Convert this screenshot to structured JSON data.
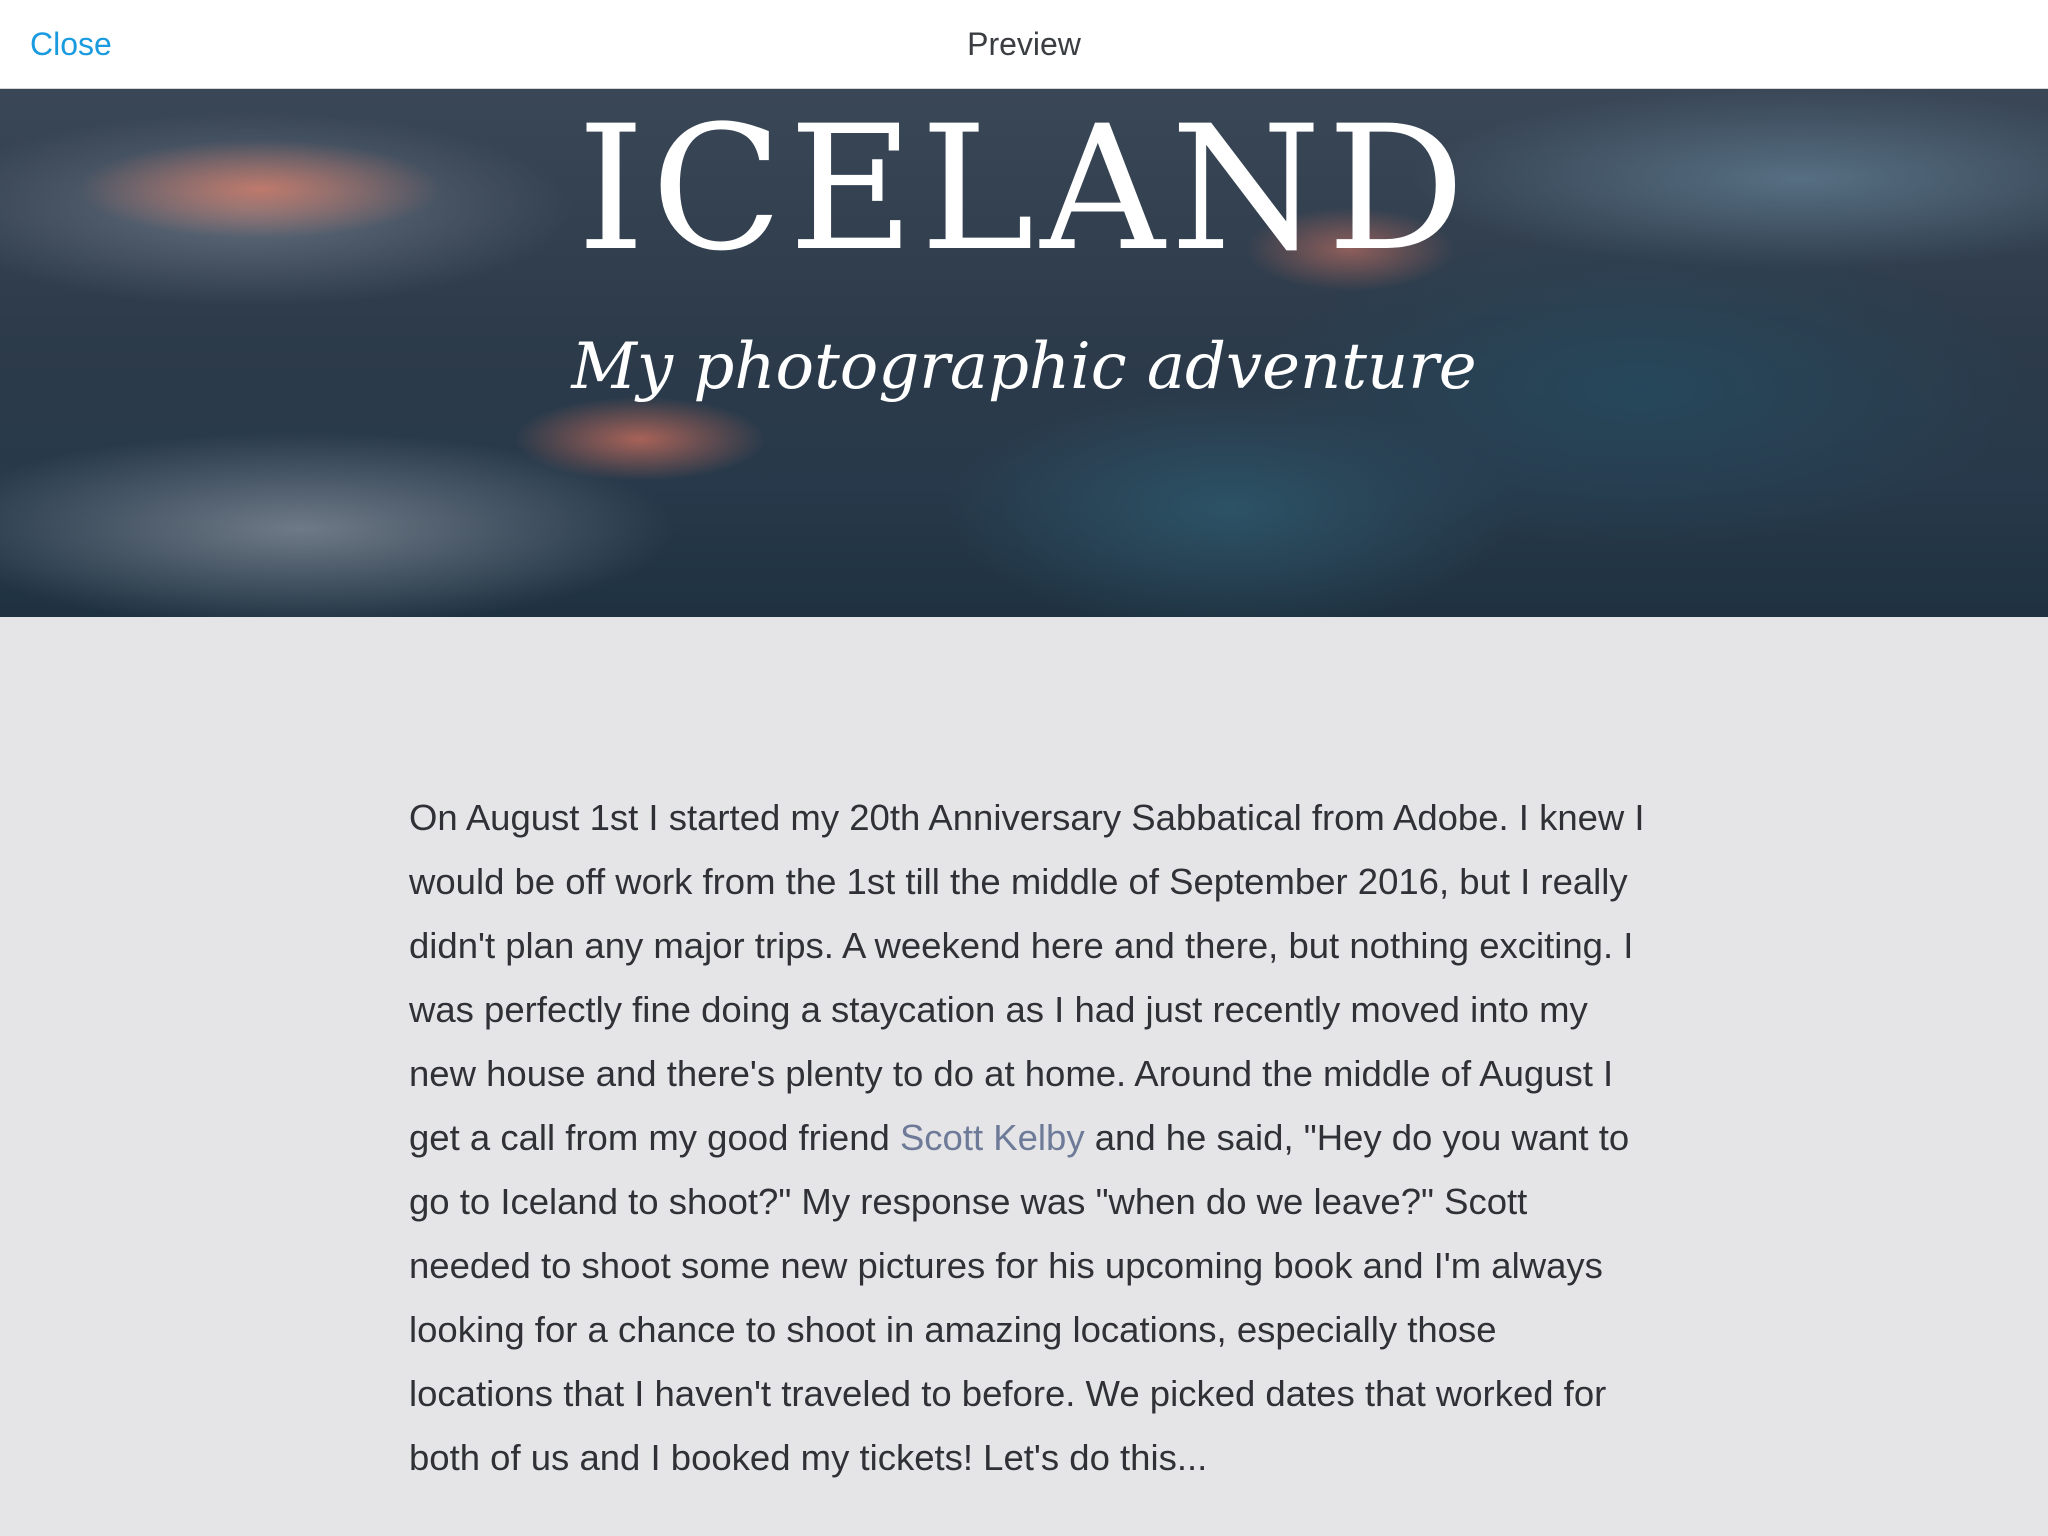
{
  "topbar": {
    "close_label": "Close",
    "title": "Preview"
  },
  "hero": {
    "title": "ICELAND",
    "subtitle": "My photographic adventure"
  },
  "article": {
    "text_before_link": "On August 1st I started my 20th Anniversary Sabbatical from Adobe. I knew I would be off work from the 1st till the middle of September 2016, but I really didn't plan any major trips. A weekend here and there, but nothing exciting. I was perfectly fine doing a staycation as I had just recently moved into my new house and there's plenty to do at home. Around the middle of August I get a call from my good friend ",
    "link_text": "Scott Kelby",
    "text_after_link": " and he said, \"Hey do you want to go to Iceland to shoot?\" My response was \"when do we leave?\" Scott needed to shoot some new pictures for his upcoming book and I'm always looking for a chance to shoot in amazing locations, especially those locations that I haven't traveled to before. We picked dates that worked for both of us and I booked my tickets! Let's do this..."
  },
  "colors": {
    "accent": "#1a9be0",
    "link": "#6d7a98",
    "background": "#e5e5e7"
  }
}
